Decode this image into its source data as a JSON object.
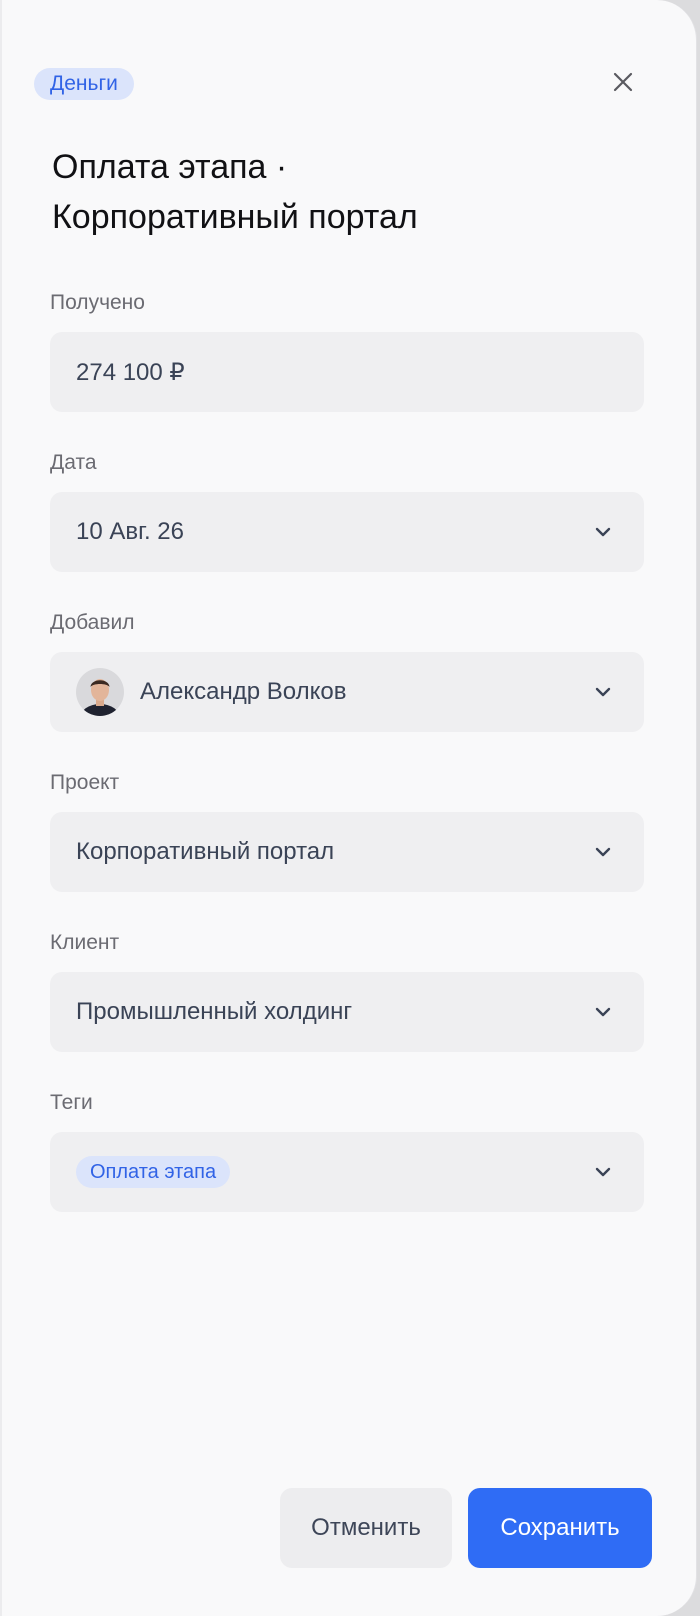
{
  "header": {
    "badge": "Деньги",
    "title_line1": "Оплата этапа ·",
    "title_line2": "Корпоративный портал"
  },
  "fields": {
    "received": {
      "label": "Получено",
      "value": "274 100 ₽"
    },
    "date": {
      "label": "Дата",
      "value": "10 Авг. 26"
    },
    "added_by": {
      "label": "Добавил",
      "value": "Александр Волков"
    },
    "project": {
      "label": "Проект",
      "value": "Корпоративный портал"
    },
    "client": {
      "label": "Клиент",
      "value": "Промышленный холдинг"
    },
    "tags": {
      "label": "Теги",
      "chips": [
        "Оплата этапа"
      ]
    }
  },
  "footer": {
    "cancel_label": "Отменить",
    "save_label": "Сохранить"
  },
  "icons": {
    "close": "close-icon",
    "chevron": "chevron-down-icon",
    "avatar": "avatar"
  },
  "colors": {
    "accent": "#2f6cf5",
    "badge_bg": "#dbe4fb",
    "badge_text": "#3163e6",
    "field_bg": "#efeff1",
    "panel_bg": "#f9f9fa"
  }
}
